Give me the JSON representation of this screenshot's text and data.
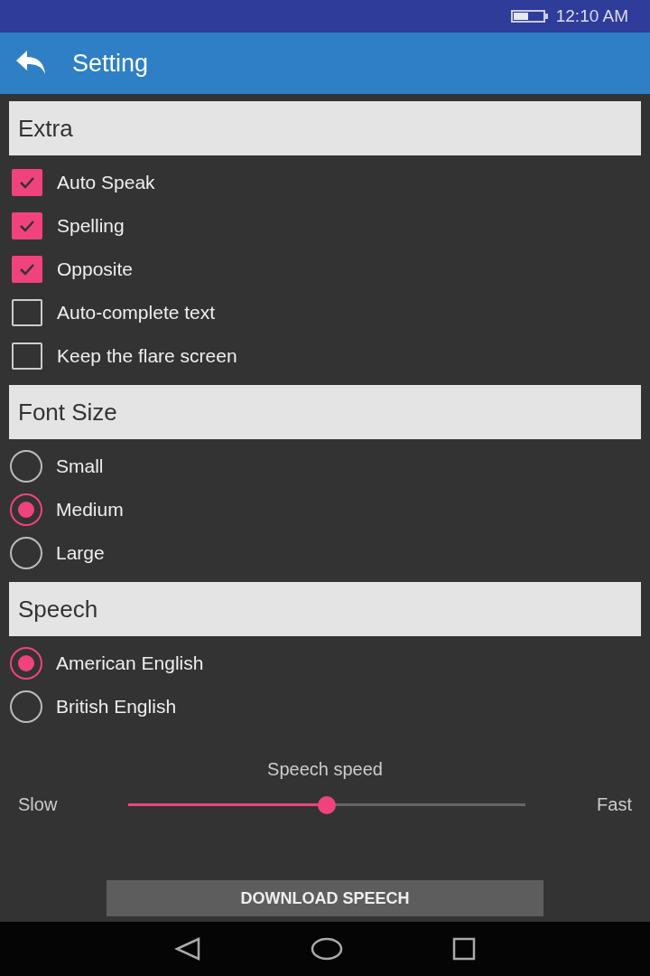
{
  "status_bar": {
    "time": "12:10 AM"
  },
  "app_bar": {
    "title": "Setting"
  },
  "sections": [
    {
      "title": "Extra",
      "items": [
        {
          "kind": "checkbox",
          "label": "Auto Speak",
          "checked": true
        },
        {
          "kind": "checkbox",
          "label": "Spelling",
          "checked": true
        },
        {
          "kind": "checkbox",
          "label": "Opposite",
          "checked": true
        },
        {
          "kind": "checkbox",
          "label": "Auto-complete text",
          "checked": false
        },
        {
          "kind": "checkbox",
          "label": "Keep the flare screen",
          "checked": false
        }
      ]
    },
    {
      "title": "Font Size",
      "items": [
        {
          "kind": "radio",
          "label": "Small",
          "selected": false
        },
        {
          "kind": "radio",
          "label": "Medium",
          "selected": true
        },
        {
          "kind": "radio",
          "label": "Large",
          "selected": false
        }
      ]
    },
    {
      "title": "Speech",
      "items": [
        {
          "kind": "radio",
          "label": "American English",
          "selected": true
        },
        {
          "kind": "radio",
          "label": "British English",
          "selected": false
        }
      ]
    }
  ],
  "speed": {
    "title": "Speech speed",
    "min_label": "Slow",
    "max_label": "Fast",
    "level": 0.5
  },
  "download_button": "DOWNLOAD SPEECH"
}
